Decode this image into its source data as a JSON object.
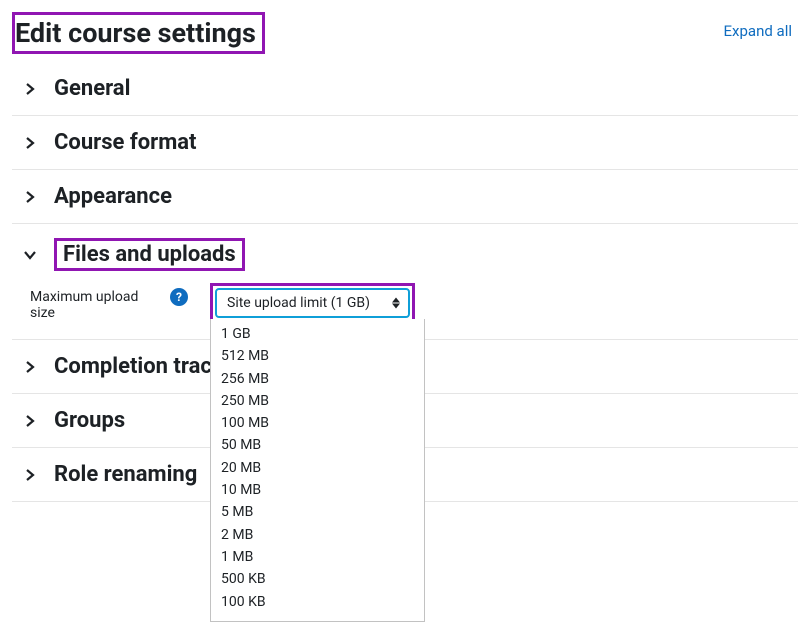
{
  "page": {
    "title": "Edit course settings",
    "expandAll": "Expand all"
  },
  "sections": {
    "general": {
      "title": "General"
    },
    "courseFormat": {
      "title": "Course format"
    },
    "appearance": {
      "title": "Appearance"
    },
    "filesUploads": {
      "title": "Files and uploads",
      "fieldLabel": "Maximum upload size",
      "selectedValue": "Site upload limit (1 GB)",
      "options": [
        "1 GB",
        "512 MB",
        "256 MB",
        "250 MB",
        "100 MB",
        "50 MB",
        "20 MB",
        "10 MB",
        "5 MB",
        "2 MB",
        "1 MB",
        "500 KB",
        "100 KB"
      ]
    },
    "completionTracking": {
      "title": "Completion tracking"
    },
    "groups": {
      "title": "Groups"
    },
    "roleRenaming": {
      "title": "Role renaming"
    }
  },
  "helpGlyph": "?"
}
